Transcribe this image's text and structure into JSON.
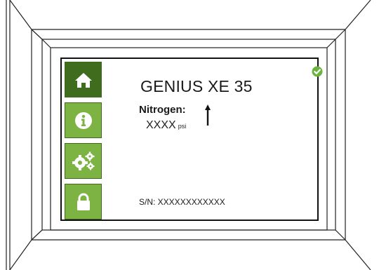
{
  "device": {
    "title": "GENIUS XE 35",
    "status_icon": "check-circle-icon",
    "status_color": "#6db33f"
  },
  "nav": {
    "active_color": "#3f6d1d",
    "inactive_color": "#7cb342",
    "items": [
      {
        "id": "home",
        "icon": "home-icon",
        "active": true
      },
      {
        "id": "info",
        "icon": "info-icon",
        "active": false
      },
      {
        "id": "settings",
        "icon": "gears-icon",
        "active": false
      },
      {
        "id": "lock",
        "icon": "lock-icon",
        "active": false
      }
    ]
  },
  "reading": {
    "label": "Nitrogen:",
    "value": "XXXX",
    "unit": "psi",
    "trend_icon": "arrow-up-icon"
  },
  "serial": {
    "text": "S/N: XXXXXXXXXXXX"
  }
}
